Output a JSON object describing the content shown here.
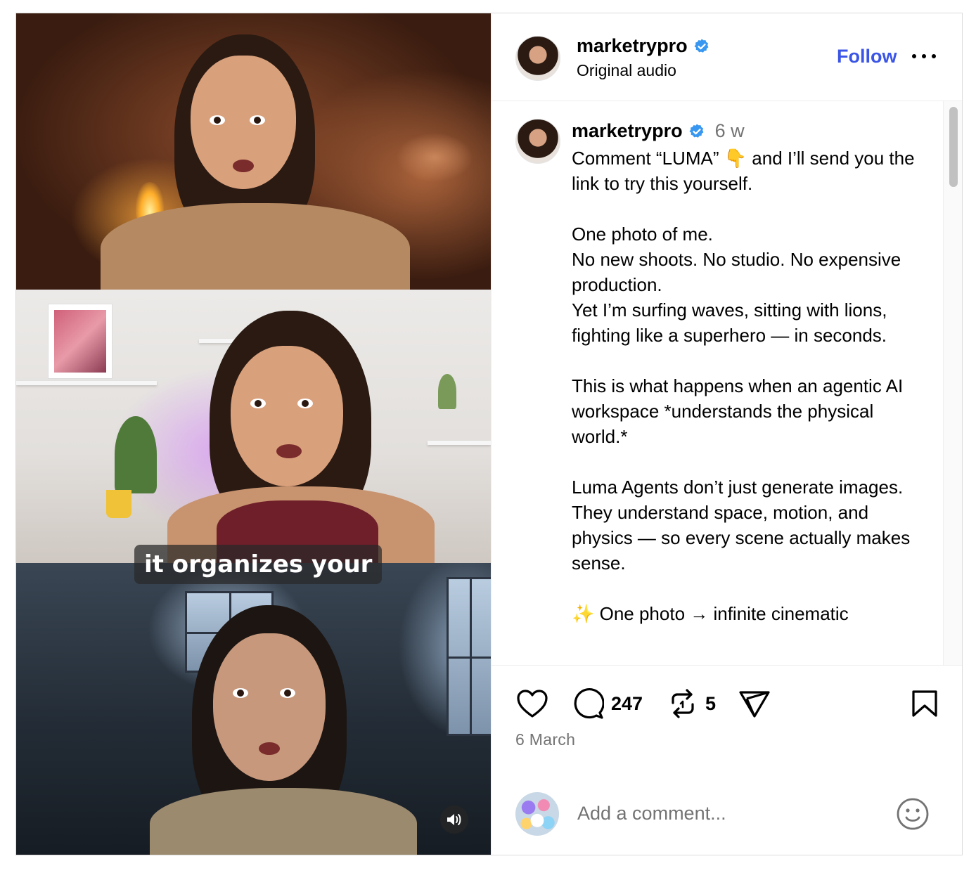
{
  "post": {
    "username": "marketrypro",
    "audio_label": "Original audio",
    "follow_label": "Follow",
    "video_caption_overlay": "it organizes your"
  },
  "caption": {
    "username": "marketrypro",
    "time_ago": "6 w",
    "lines": [
      "Comment “LUMA” 👇 and I’ll send you the link to try this yourself.",
      "",
      "One photo of me.",
      "No new shoots. No studio. No expensive production.",
      "Yet I’m surfing waves, sitting with lions, fighting like a superhero — in seconds.",
      "",
      "This is what happens when an agentic AI workspace *understands the physical world.*",
      "",
      "Luma Agents don’t just generate images.",
      "They understand space, motion, and physics — so every scene actually makes sense.",
      "",
      "✨ One photo → infinite cinematic"
    ]
  },
  "actions": {
    "comments_count": "247",
    "reposts_count": "5"
  },
  "post_date": "6 March",
  "comment_box": {
    "placeholder": "Add a comment..."
  },
  "icons": {
    "verified": "verified-badge-icon",
    "like": "heart-icon",
    "comment": "speech-bubble-icon",
    "repost": "repost-icon",
    "share": "paper-plane-icon",
    "save": "bookmark-icon",
    "emoji": "smiley-icon",
    "sound": "speaker-icon",
    "more": "ellipsis-icon"
  },
  "colors": {
    "follow_blue": "#3b55e6",
    "verified_blue": "#3897f0",
    "muted_text": "#737373"
  }
}
